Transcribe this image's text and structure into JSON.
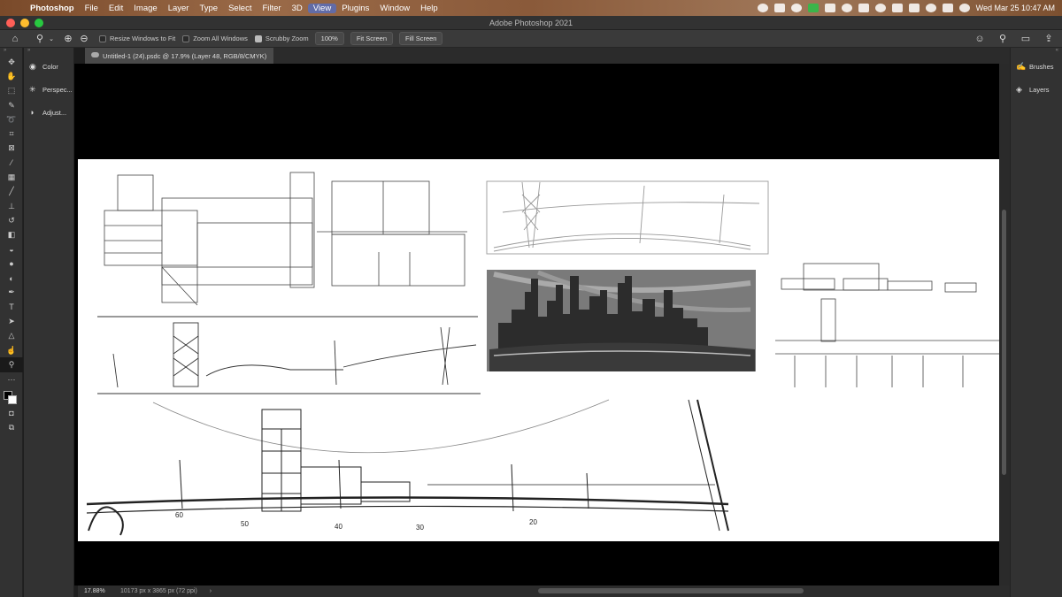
{
  "menubar": {
    "items": [
      "Photoshop",
      "File",
      "Edit",
      "Image",
      "Layer",
      "Type",
      "Select",
      "Filter",
      "3D",
      "View",
      "Plugins",
      "Window",
      "Help"
    ],
    "active": "View",
    "clock": "Wed Mar 25  10:47 AM"
  },
  "window": {
    "title": "Adobe Photoshop 2021"
  },
  "options": {
    "resize_windows": "Resize Windows to Fit",
    "zoom_all": "Zoom All Windows",
    "scrubby": "Scrubby Zoom",
    "pct_button": "100%",
    "fit_screen": "Fit Screen",
    "fill_screen": "Fill Screen"
  },
  "document": {
    "tab_label": "Untitled-1 (24).psdc @ 17.9% (Layer 48, RGB/8/CMYK)"
  },
  "dock_left": {
    "items": [
      {
        "icon": "color-wheel-icon",
        "label": "Color"
      },
      {
        "icon": "perspective-grid-icon",
        "label": "Perspec..."
      },
      {
        "icon": "adjustments-icon",
        "label": "Adjust..."
      }
    ]
  },
  "dock_right": {
    "items": [
      {
        "icon": "brushes-icon",
        "label": "Brushes"
      },
      {
        "icon": "layers-icon",
        "label": "Layers"
      }
    ]
  },
  "status": {
    "zoom": "17.88%",
    "dims": "10173 px x 3865 px (72 ppi)",
    "arrow": "›"
  },
  "sketch": {
    "distance_labels": [
      "60",
      "50",
      "40",
      "30",
      "20"
    ]
  },
  "colors": {
    "canvas_bg": "#000000",
    "artboard": "#ffffff",
    "panel": "#323232",
    "accent": "#4e6ec8"
  }
}
